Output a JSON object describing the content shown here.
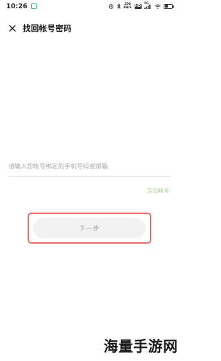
{
  "status_bar": {
    "time": "10:26",
    "network_speed_value": "250",
    "network_speed_unit": "KB/S",
    "hd_badge": "HD",
    "signal_label": "5G",
    "icons": [
      "notification-icon",
      "alarm-icon",
      "bluetooth-icon",
      "hd-badge-icon",
      "signal-icon",
      "wifi-icon",
      "battery-icon"
    ],
    "battery_level": 0.4
  },
  "header": {
    "close_icon": "close-icon",
    "title": "找回帐号密码"
  },
  "form": {
    "account_placeholder": "请输入您帐号绑定的手机号码或邮箱",
    "account_value": "",
    "forgot_account_label": "忘记帐号"
  },
  "actions": {
    "next_label": "下一步"
  },
  "watermark": {
    "text": "海量手游网"
  },
  "colors": {
    "accent_link": "#a8c98a",
    "highlight_border": "#ec6b6b",
    "button_bg": "#f1f2f1",
    "button_text": "#9a9a9a"
  }
}
